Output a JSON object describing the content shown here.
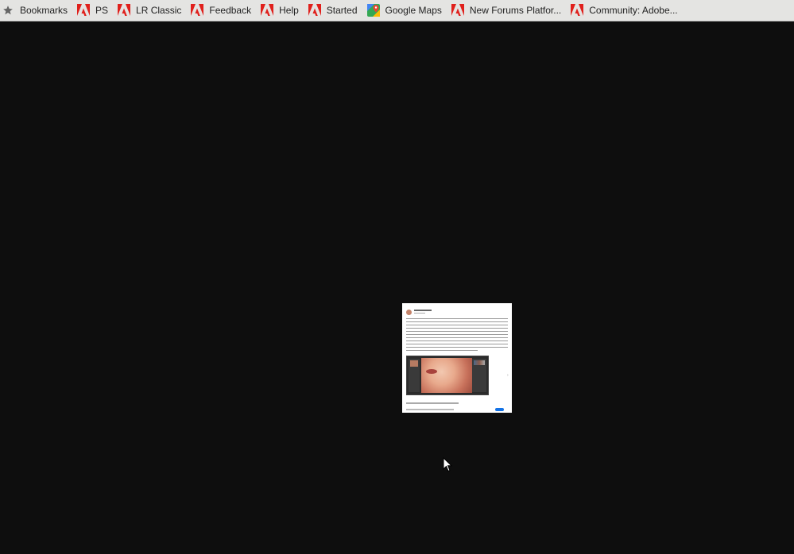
{
  "bookmarks_bar": {
    "items": [
      {
        "label": "Bookmarks",
        "icon": "star-icon"
      },
      {
        "label": "PS",
        "icon": "adobe-icon"
      },
      {
        "label": "LR Classic",
        "icon": "adobe-icon"
      },
      {
        "label": "Feedback",
        "icon": "adobe-icon"
      },
      {
        "label": "Help",
        "icon": "adobe-icon"
      },
      {
        "label": "Started",
        "icon": "adobe-icon"
      },
      {
        "label": "Google Maps",
        "icon": "google-maps-icon"
      },
      {
        "label": "New Forums Platfor...",
        "icon": "adobe-icon"
      },
      {
        "label": "Community: Adobe...",
        "icon": "adobe-icon"
      }
    ]
  },
  "colors": {
    "bar_background": "#e4e4e2",
    "viewer_background": "#0e0e0e",
    "adobe_red": "#e0201c",
    "accent_blue": "#1473e6"
  }
}
